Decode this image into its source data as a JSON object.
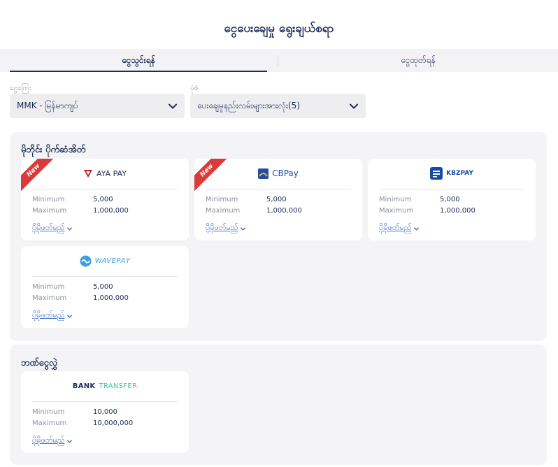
{
  "page": {
    "title": "ငွေပေးချေမှု ရွေးချယ်စရာ"
  },
  "tabs": [
    {
      "label": "ငွေသွင်းရန်",
      "active": true
    },
    {
      "label": "ငွေထုတ်ရန်",
      "active": false
    }
  ],
  "filters": {
    "currency_label": "ငွေကြေး",
    "currency_value": "MMK - မြန်မာကျပ်",
    "type_label": "ပုံစံ",
    "type_value": "ပေးချေမှုနည်းလမ်းများအားလုံး(5)"
  },
  "labels": {
    "minimum": "Minimum",
    "maximum": "Maximum",
    "more": "ပိုမိုဖတ်မည်",
    "new_badge": "New"
  },
  "sections": [
    {
      "title": "မိုဘိုင်း ပိုက်ဆံအိတ်",
      "methods": [
        {
          "name": "AYA PAY",
          "min": "5,000",
          "max": "1,000,000",
          "is_new": true,
          "icon": "aya-pay-logo",
          "color": "#b3262e"
        },
        {
          "name": "CBPay",
          "min": "5,000",
          "max": "1,000,000",
          "is_new": true,
          "icon": "cb-pay-logo",
          "color": "#1e4fa8"
        },
        {
          "name": "KBZPAY",
          "min": "5,000",
          "max": "1,000,000",
          "is_new": false,
          "icon": "kbz-pay-logo",
          "color": "#1649a8"
        },
        {
          "name": "WAVEPAY",
          "min": "5,000",
          "max": "1,000,000",
          "is_new": false,
          "icon": "wave-pay-logo",
          "color": "#3aa0e0"
        }
      ]
    },
    {
      "title": "ဘဏ်ငွေလွှဲ",
      "methods": [
        {
          "name_part1": "BANK",
          "name_part2": "TRANSFER",
          "min": "10,000",
          "max": "10,000,000",
          "is_new": false,
          "icon": "bank-transfer-logo",
          "color": "#3ec7a4"
        }
      ]
    }
  ]
}
